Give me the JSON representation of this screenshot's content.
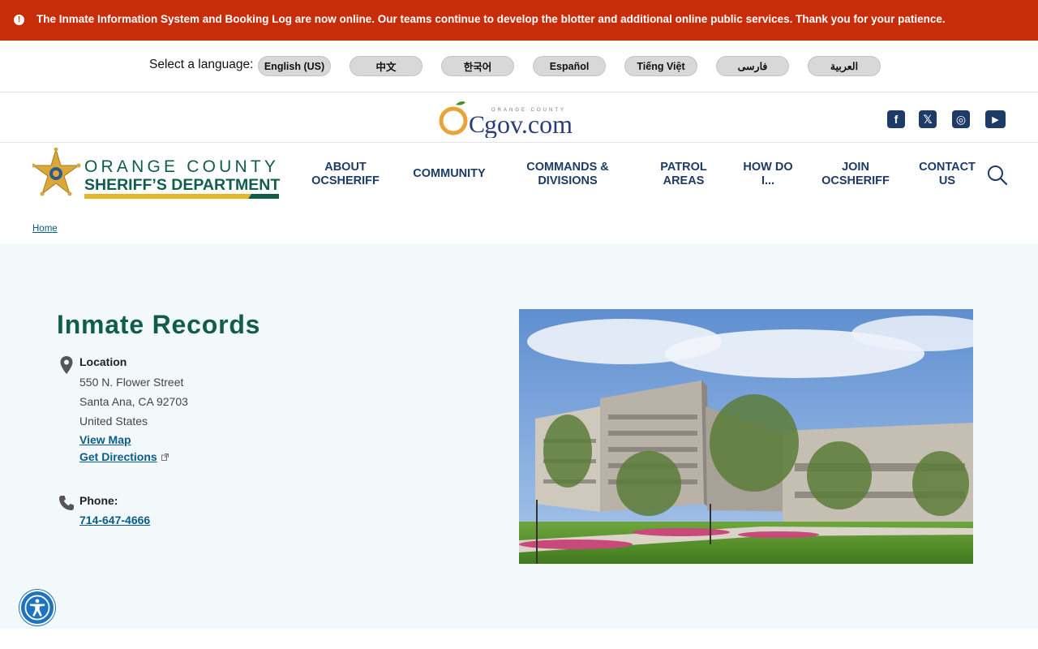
{
  "alert": {
    "text": "The Inmate Information System and Booking Log are now online. Our teams continue to develop the blotter and additional online public services. Thank you for your patience.",
    "color": "#c82d0a"
  },
  "language": {
    "label": "Select a language:",
    "options": [
      "English (US)",
      "中文",
      "한국어",
      "Español",
      "Tiếng Việt",
      "فارسی",
      "العربية"
    ]
  },
  "gov_logo": {
    "oc": "OC",
    "gov": "gov.com",
    "tag": "ORANGE COUNTY"
  },
  "social": {
    "facebook": "f",
    "x": "𝕏",
    "instagram": "◎",
    "youtube": "▶"
  },
  "brand": {
    "line1": "ORANGE COUNTY",
    "line2": "SHERIFF’S DEPARTMENT",
    "primary_color": "#115d4c",
    "gold_color": "#e5b62a"
  },
  "nav": [
    {
      "line1": "ABOUT",
      "line2": "OCSHERIFF"
    },
    {
      "line1": "COMMUNITY",
      "line2": ""
    },
    {
      "line1": "COMMANDS &",
      "line2": "DIVISIONS"
    },
    {
      "line1": "PATROL",
      "line2": "AREAS"
    },
    {
      "line1": "HOW DO",
      "line2": "I..."
    },
    {
      "line1": "JOIN",
      "line2": "OCSHERIFF"
    },
    {
      "line1": "CONTACT",
      "line2": "US"
    }
  ],
  "breadcrumb": {
    "home": "Home"
  },
  "page": {
    "title": "Inmate Records",
    "location_label": "Location",
    "address": [
      "550 N. Flower Street",
      "Santa Ana, CA 92703",
      "United States"
    ],
    "view_map": "View Map",
    "get_directions": "Get Directions",
    "phone_label": "Phone:",
    "phone": "714-647-4666"
  }
}
